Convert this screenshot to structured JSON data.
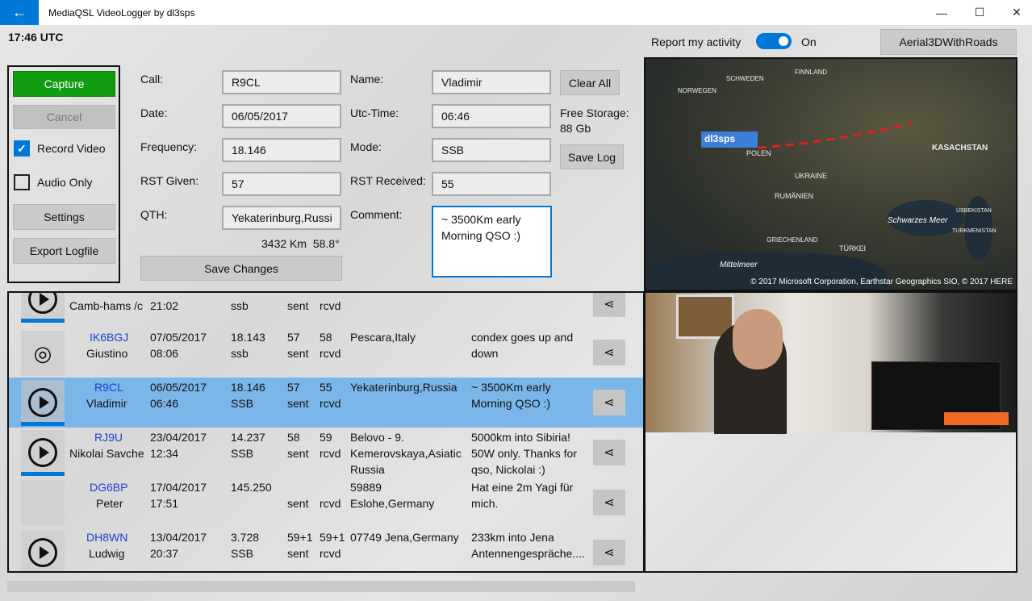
{
  "window": {
    "title": "MediaQSL VideoLogger by dl3sps",
    "back": "←",
    "minimize": "—",
    "maximize": "☐",
    "close": "✕"
  },
  "utc": "17:46 UTC",
  "activity": {
    "label": "Report my activity",
    "state": "On",
    "map_mode": "Aerial3DWithRoads"
  },
  "left": {
    "capture": "Capture",
    "cancel": "Cancel",
    "record_video": "Record Video",
    "audio_only": "Audio Only",
    "settings": "Settings",
    "export": "Export Logfile"
  },
  "form": {
    "call_label": "Call:",
    "call": "R9CL",
    "date_label": "Date:",
    "date": "06/05/2017",
    "freq_label": "Frequency:",
    "freq": "18.146",
    "rst_given_label": "RST Given:",
    "rst_given": "57",
    "qth_label": "QTH:",
    "qth": "Yekaterinburg,Russi",
    "distance": "3432 Km  58.8°",
    "save_changes": "Save Changes",
    "name_label": "Name:",
    "name": "Vladimir",
    "utc_label": "Utc-Time:",
    "utc_time": "06:46",
    "mode_label": "Mode:",
    "mode": "SSB",
    "rst_recv_label": "RST Received:",
    "rst_recv": "55",
    "comment_label": "Comment:",
    "comment": "~ 3500Km early Morning QSO :)",
    "clear_all": "Clear All",
    "storage_label": "Free Storage:",
    "storage": "88 Gb",
    "save_log": "Save Log"
  },
  "map": {
    "callsign": "dl3sps",
    "copyright": "© 2017 Microsoft Corporation, Earthstar Geographics  SIO, © 2017 HERE",
    "labels": [
      "KASACHSTAN",
      "UKRAINE",
      "POLEN",
      "RUMÄNIEN",
      "Schwarzes Meer",
      "TÜRKEI",
      "GRIECHENLAND",
      "Mittelmeer",
      "FINNLAND",
      "SCHWEDEN",
      "NORWEGEN",
      "USBEKISTAN",
      "TURKMENISTAN"
    ]
  },
  "log": [
    {
      "call": "",
      "name": "Camb-hams /c",
      "date": "",
      "time": "21:02",
      "freq": "",
      "mode": "ssb",
      "rst_s": "",
      "sent": "sent",
      "rst_r": "",
      "rcvd": "rcvd",
      "qth": "",
      "comment": ""
    },
    {
      "call": "IK6BGJ",
      "name": "Giustino",
      "date": "07/05/2017",
      "time": "08:06",
      "freq": "18.143",
      "mode": "ssb",
      "rst_s": "57",
      "sent": "sent",
      "rst_r": "58",
      "rcvd": "rcvd",
      "qth": "Pescara,Italy",
      "comment": "condex goes  up and down"
    },
    {
      "call": "R9CL",
      "name": "Vladimir",
      "date": "06/05/2017",
      "time": "06:46",
      "freq": "18.146",
      "mode": "SSB",
      "rst_s": "57",
      "sent": "sent",
      "rst_r": "55",
      "rcvd": "rcvd",
      "qth": "Yekaterinburg,Russia",
      "comment": "~ 3500Km early Morning QSO :)"
    },
    {
      "call": "RJ9U",
      "name": "Nikolai Savche",
      "date": "23/04/2017",
      "time": "12:34",
      "freq": "14.237",
      "mode": "SSB",
      "rst_s": "58",
      "sent": "sent",
      "rst_r": "59",
      "rcvd": "rcvd",
      "qth": "Belovo - 9. Kemerovskaya,Asiatic Russia",
      "comment": "5000km into Sibiria! 50W only. Thanks for qso, Nickolai :)"
    },
    {
      "call": "DG6BP",
      "name": "Peter",
      "date": "17/04/2017",
      "time": "17:51",
      "freq": "145.250",
      "mode": "",
      "rst_s": "",
      "sent": "sent",
      "rst_r": "",
      "rcvd": "rcvd",
      "qth": "59889 Eslohe,Germany",
      "comment": "Hat eine 2m Yagi für mich."
    },
    {
      "call": "DH8WN",
      "name": "Ludwig",
      "date": "13/04/2017",
      "time": "20:37",
      "freq": "3.728",
      "mode": "SSB",
      "rst_s": "59+1",
      "sent": "sent",
      "rst_r": "59+1",
      "rcvd": "rcvd",
      "qth": "07749 Jena,Germany",
      "comment": "233km into Jena Antennengespräche...."
    }
  ],
  "icons": {
    "share": "share-icon",
    "play": "play-icon",
    "reel": "film-reel-icon"
  }
}
